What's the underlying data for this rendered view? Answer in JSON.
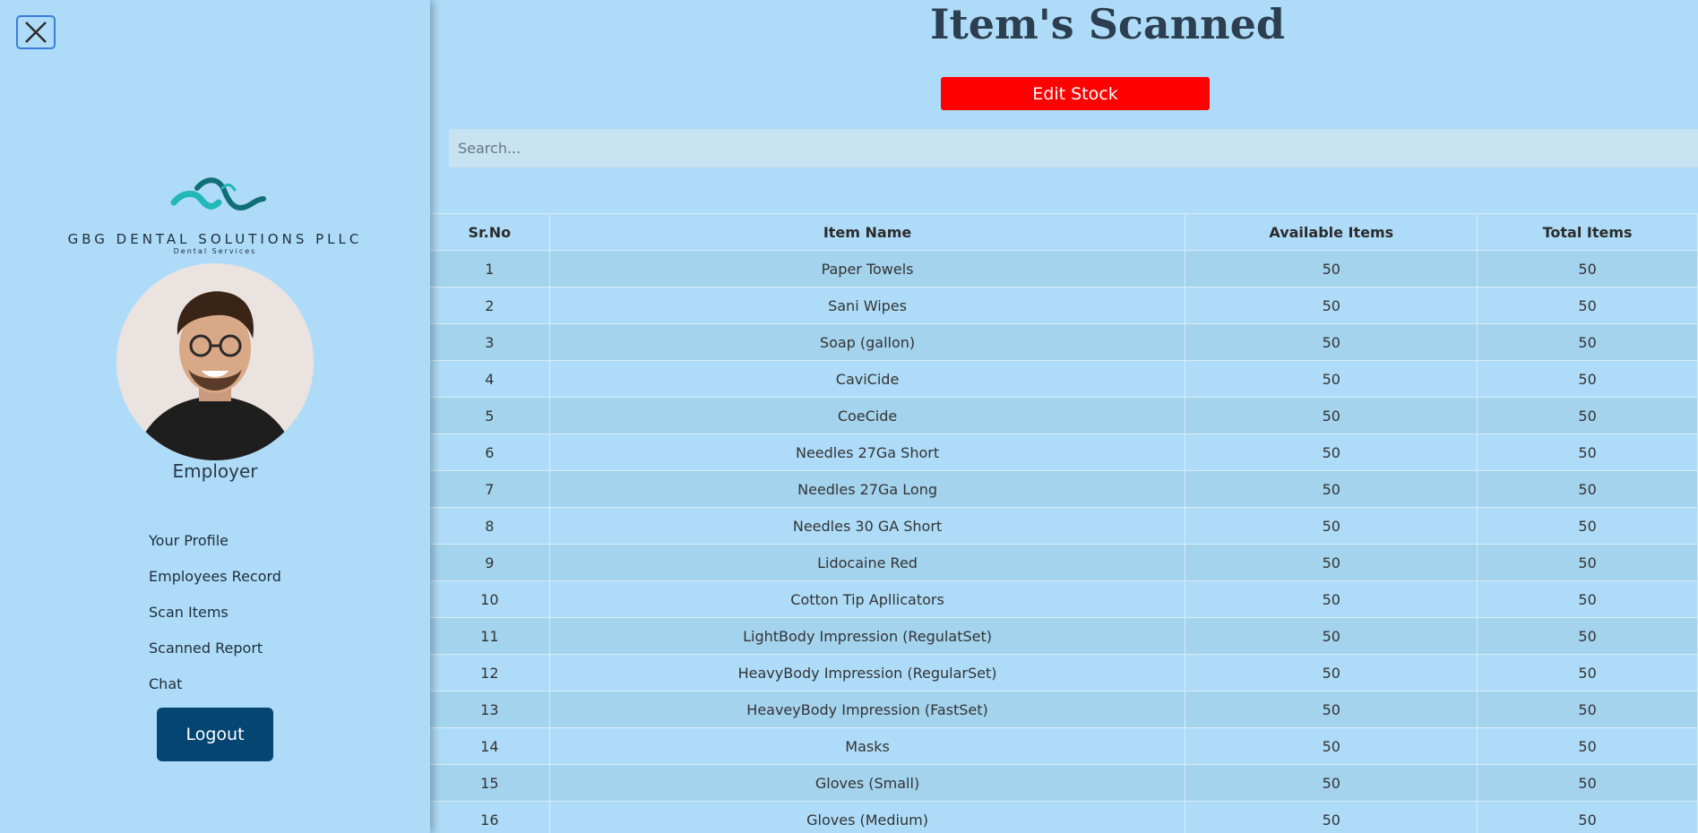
{
  "sidebar": {
    "close_icon": "close-icon",
    "logo": {
      "name": "GBG DENTAL SOLUTIONS PLLC",
      "tagline": "Dental Services"
    },
    "role": "Employer",
    "nav": [
      {
        "label": "Your Profile"
      },
      {
        "label": "Employees Record"
      },
      {
        "label": "Scan Items"
      },
      {
        "label": "Scanned Report"
      },
      {
        "label": "Chat"
      }
    ],
    "logout_label": "Logout"
  },
  "main": {
    "title": "Item's Scanned",
    "edit_stock_label": "Edit Stock",
    "search_placeholder": "Search...",
    "table": {
      "headers": [
        "Sr.No",
        "Item Name",
        "Available Items",
        "Total Items"
      ],
      "rows": [
        [
          "1",
          "Paper Towels",
          "50",
          "50"
        ],
        [
          "2",
          "Sani Wipes",
          "50",
          "50"
        ],
        [
          "3",
          "Soap (gallon)",
          "50",
          "50"
        ],
        [
          "4",
          "CaviCide",
          "50",
          "50"
        ],
        [
          "5",
          "CoeCide",
          "50",
          "50"
        ],
        [
          "6",
          "Needles 27Ga Short",
          "50",
          "50"
        ],
        [
          "7",
          "Needles 27Ga Long",
          "50",
          "50"
        ],
        [
          "8",
          "Needles 30 GA Short",
          "50",
          "50"
        ],
        [
          "9",
          "Lidocaine Red",
          "50",
          "50"
        ],
        [
          "10",
          "Cotton Tip Apllicators",
          "50",
          "50"
        ],
        [
          "11",
          "LightBody Impression (RegulatSet)",
          "50",
          "50"
        ],
        [
          "12",
          "HeavyBody Impression (RegularSet)",
          "50",
          "50"
        ],
        [
          "13",
          "HeaveyBody Impression (FastSet)",
          "50",
          "50"
        ],
        [
          "14",
          "Masks",
          "50",
          "50"
        ],
        [
          "15",
          "Gloves (Small)",
          "50",
          "50"
        ],
        [
          "16",
          "Gloves (Medium)",
          "50",
          "50"
        ]
      ]
    }
  },
  "colors": {
    "background": "#aedcf8",
    "edit_button": "#ff0000",
    "logout_button": "#054572",
    "logo_teal": "#1fb7b5"
  }
}
